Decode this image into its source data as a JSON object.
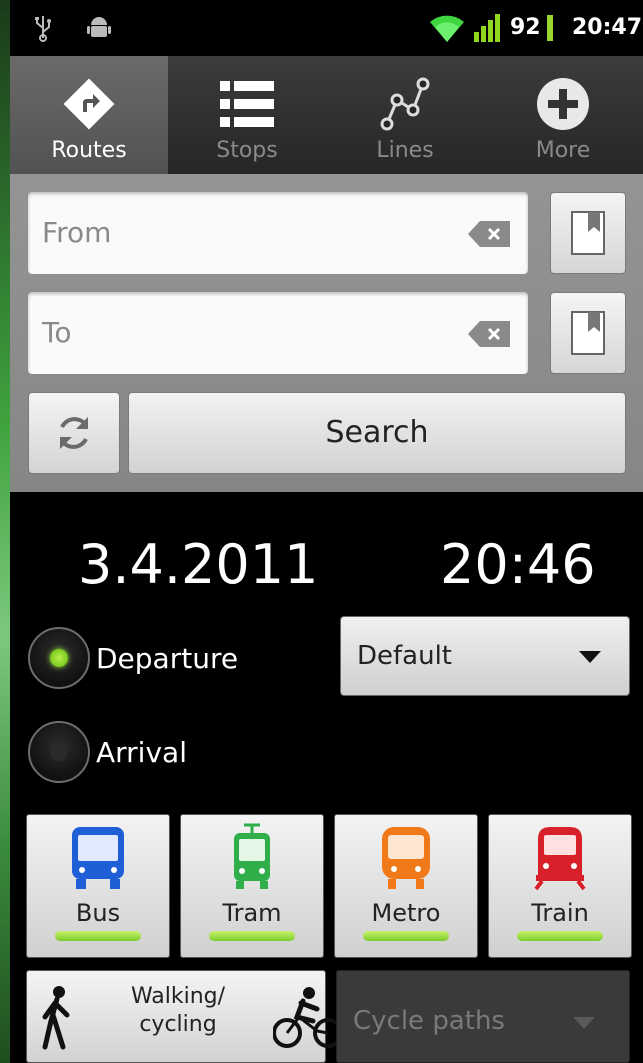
{
  "status_bar": {
    "battery_level": "92",
    "time": "20:47",
    "icons": [
      "usb-icon",
      "android-icon",
      "wifi-icon",
      "signal-icon"
    ]
  },
  "tabs": [
    {
      "label": "Routes",
      "icon": "directions-icon",
      "active": true
    },
    {
      "label": "Stops",
      "icon": "list-icon",
      "active": false
    },
    {
      "label": "Lines",
      "icon": "lines-icon",
      "active": false
    },
    {
      "label": "More",
      "icon": "plus-icon",
      "active": false
    }
  ],
  "search": {
    "from_placeholder": "From",
    "to_placeholder": "To",
    "search_label": "Search"
  },
  "datetime": {
    "date": "3.4.2011",
    "time": "20:46"
  },
  "options": {
    "departure_label": "Departure",
    "arrival_label": "Arrival",
    "selected": "Departure",
    "route_type": "Default"
  },
  "modes": [
    {
      "label": "Bus",
      "color": "#1e5fd8",
      "enabled": true
    },
    {
      "label": "Tram",
      "color": "#2fae4a",
      "enabled": true
    },
    {
      "label": "Metro",
      "color": "#f07a1a",
      "enabled": true
    },
    {
      "label": "Train",
      "color": "#d8202a",
      "enabled": true
    }
  ],
  "walking": {
    "label_line1": "Walking/",
    "label_line2": "cycling"
  },
  "cycle_paths": {
    "value": "Cycle paths"
  },
  "colors": {
    "accent_green": "#8ad12c",
    "panel_grey": "#8e8e8e"
  }
}
